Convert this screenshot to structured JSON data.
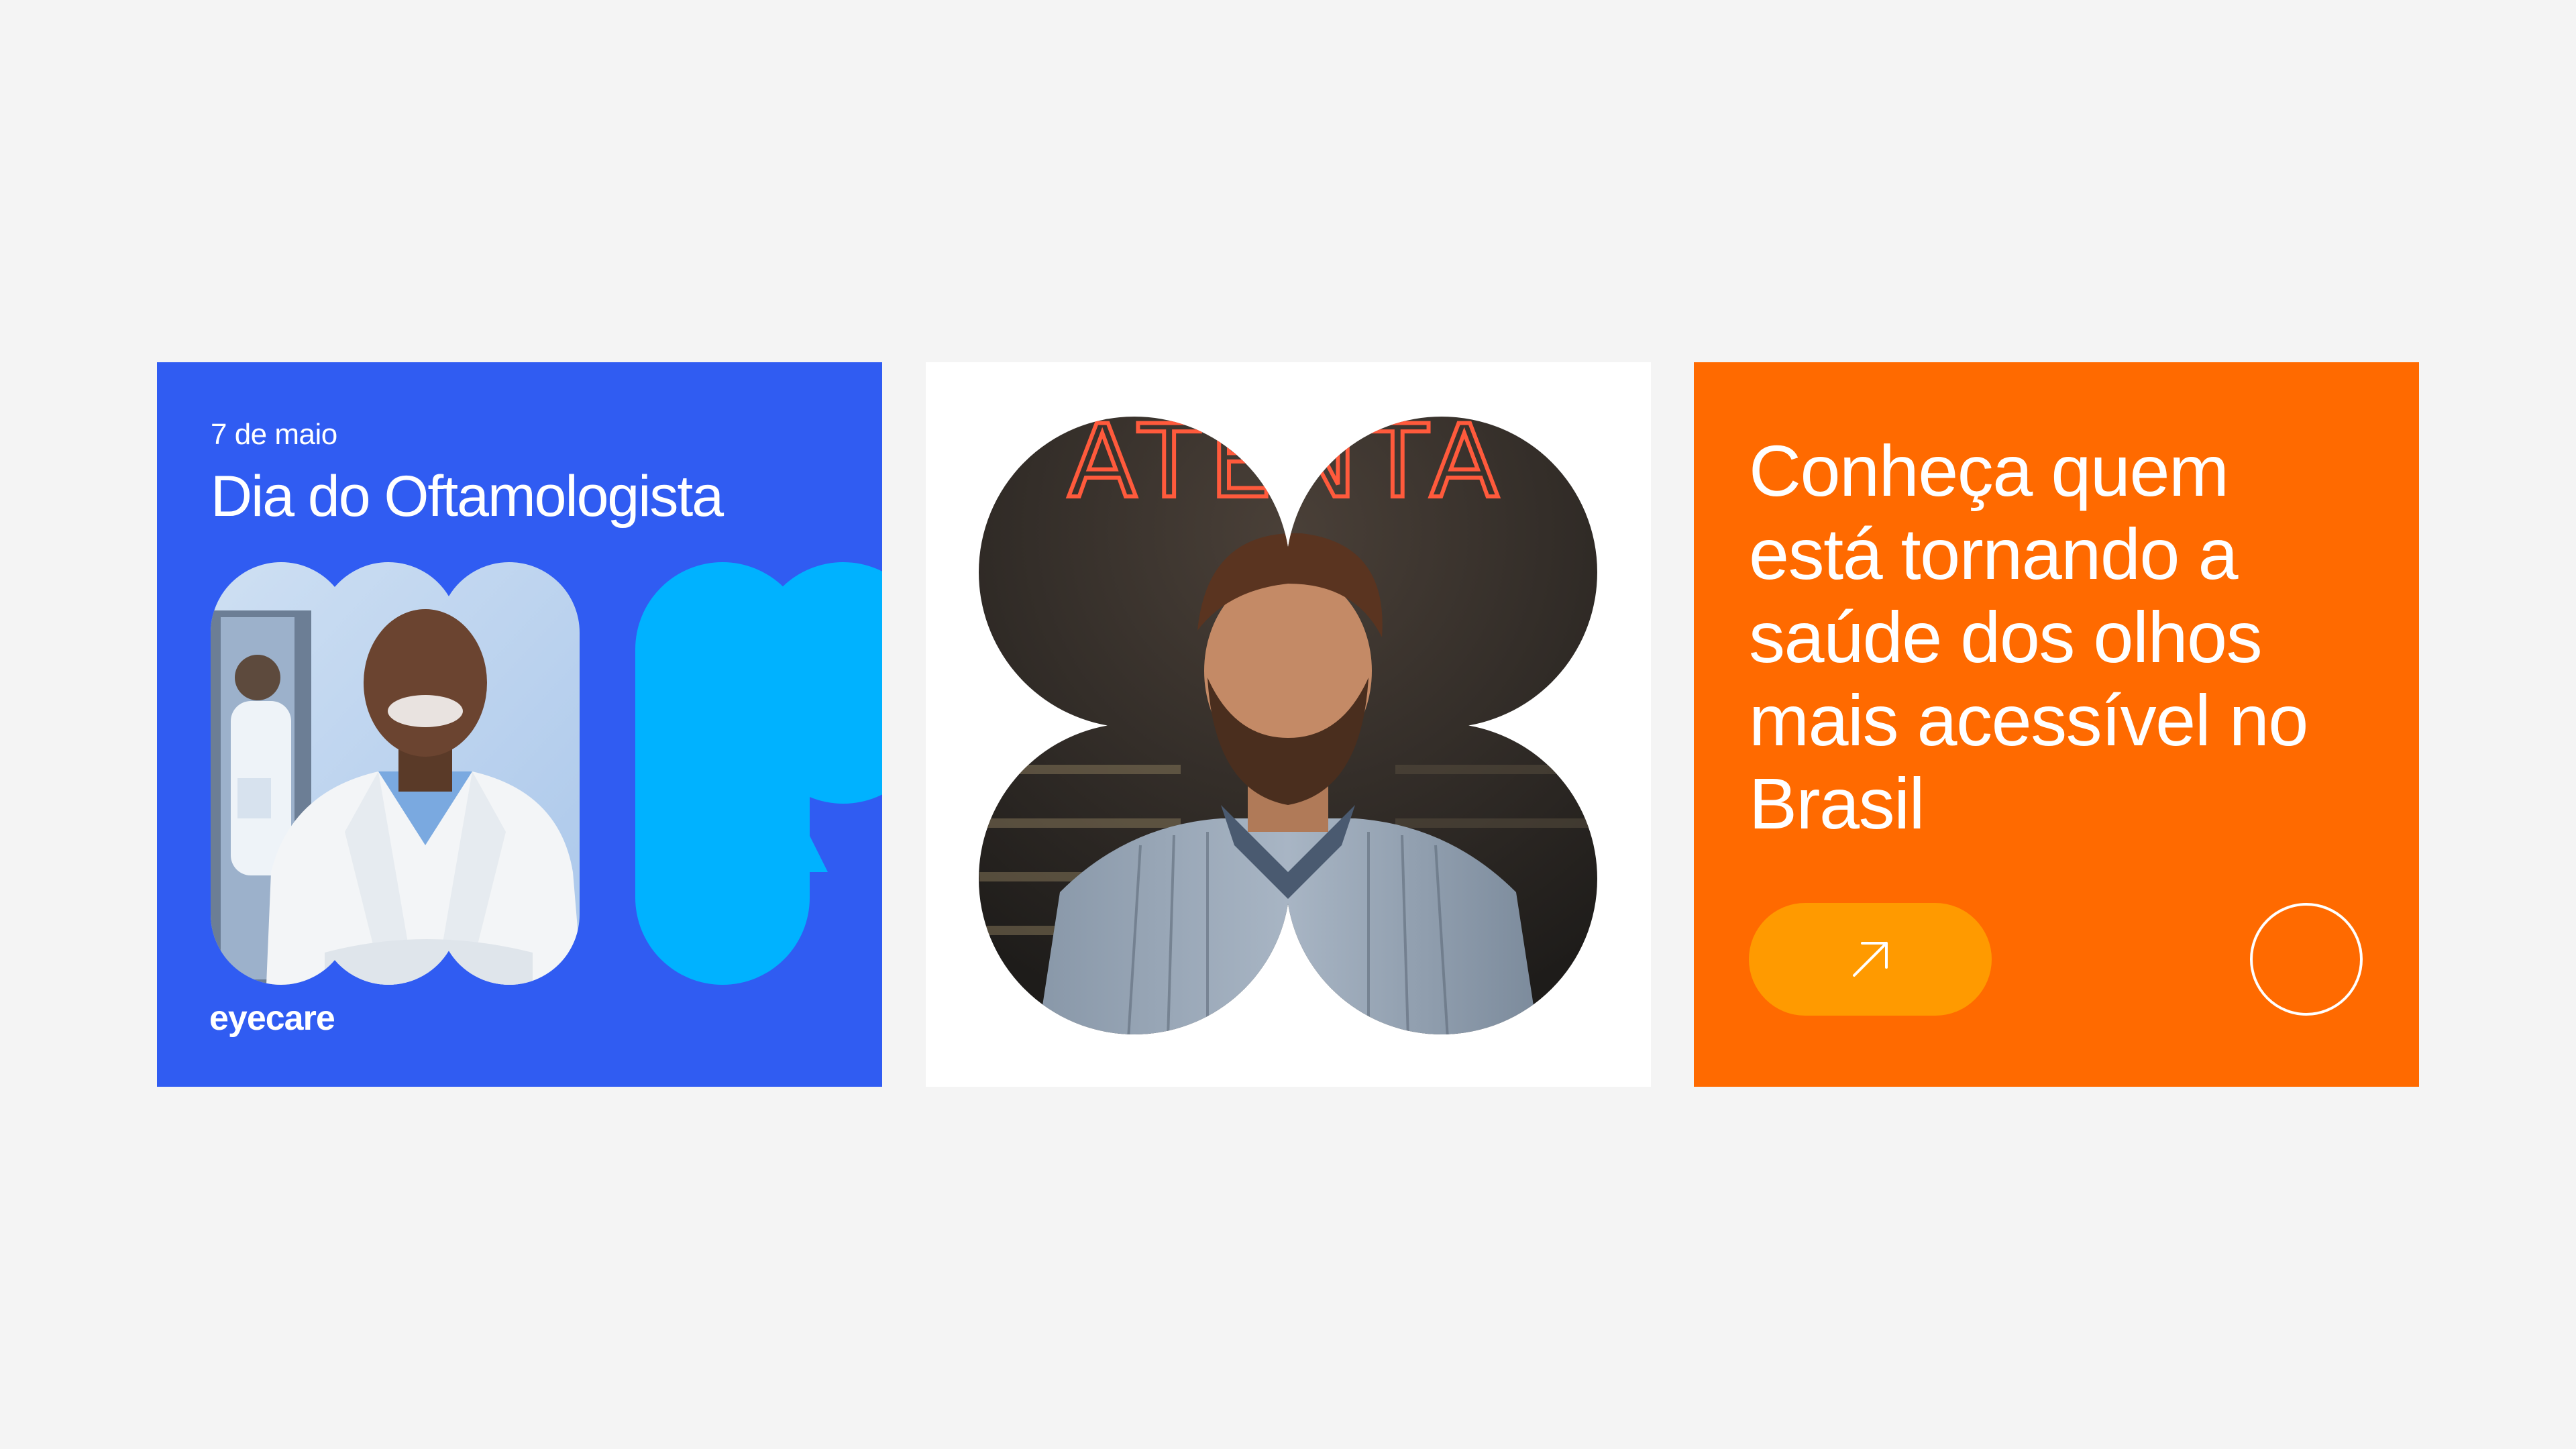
{
  "cards": {
    "blue": {
      "date": "7 de maio",
      "title": "Dia do Oftamologista",
      "logo": "eyecare",
      "color": "#305cf2",
      "accent": "#00b2ff"
    },
    "white": {
      "neon_sign": "ATENTA",
      "color": "#ffffff"
    },
    "orange": {
      "headline": "Conheça quem está tornando a saúde dos olhos mais acessível no Brasil",
      "cta_icon": "arrow-up-right-icon",
      "color": "#ff6a00",
      "button_color": "#ff9a00"
    }
  }
}
